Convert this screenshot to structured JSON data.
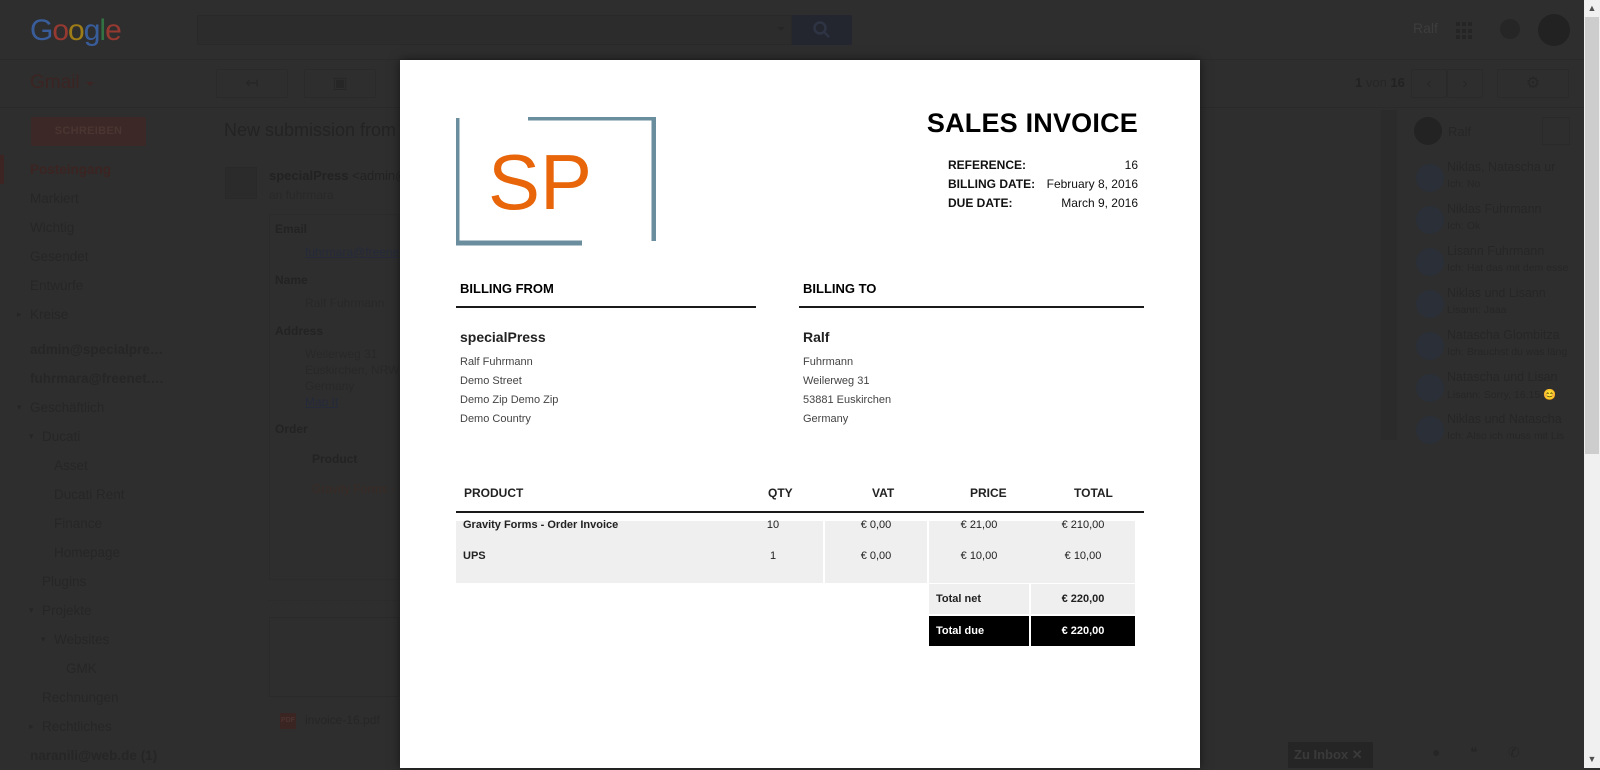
{
  "header": {
    "logo_letters": [
      {
        "ch": "G",
        "color": "#4285f4"
      },
      {
        "ch": "o",
        "color": "#ea4335"
      },
      {
        "ch": "o",
        "color": "#fbbc05"
      },
      {
        "ch": "g",
        "color": "#4285f4"
      },
      {
        "ch": "l",
        "color": "#34a853"
      },
      {
        "ch": "e",
        "color": "#ea4335"
      }
    ],
    "search_placeholder": "",
    "user_name": "Ralf"
  },
  "toolbar": {
    "app_label": "Gmail",
    "reply_icon": "↤",
    "archive_icon": "▣",
    "pager": {
      "current": "1",
      "of_label": "von",
      "total": "16"
    },
    "prev_icon": "‹",
    "next_icon": "›",
    "settings_icon": "⚙"
  },
  "sidebar": {
    "compose_label": "SCHREIBEN",
    "items": [
      {
        "label": "Posteingang",
        "style": "active",
        "indent": 0
      },
      {
        "label": "Markiert",
        "style": "",
        "indent": 0
      },
      {
        "label": "Wichtig",
        "style": "",
        "indent": 0
      },
      {
        "label": "Gesendet",
        "style": "",
        "indent": 0
      },
      {
        "label": "Entwürfe",
        "style": "",
        "indent": 0
      },
      {
        "label": "Kreise",
        "style": "",
        "indent": 0,
        "arrow": "▸"
      },
      {
        "label": "admin@specialpre…",
        "style": "bold",
        "indent": 0
      },
      {
        "label": "fuhrmara@freenet.…",
        "style": "bold",
        "indent": 0
      },
      {
        "label": "Geschäftlich",
        "style": "",
        "indent": 0,
        "arrow": "▾"
      },
      {
        "label": "Ducati",
        "style": "",
        "indent": 1,
        "arrow": "▾"
      },
      {
        "label": "Asset",
        "style": "",
        "indent": 2
      },
      {
        "label": "Ducati Rent",
        "style": "",
        "indent": 2
      },
      {
        "label": "Finance",
        "style": "",
        "indent": 2
      },
      {
        "label": "Homepage",
        "style": "",
        "indent": 2
      },
      {
        "label": "Plugins",
        "style": "",
        "indent": 1
      },
      {
        "label": "Projekte",
        "style": "",
        "indent": 1,
        "arrow": "▾"
      },
      {
        "label": "Websites",
        "style": "",
        "indent": 2,
        "arrow": "▾"
      },
      {
        "label": "GMK",
        "style": "",
        "indent": 3
      },
      {
        "label": "Rechnungen",
        "style": "",
        "indent": 1
      },
      {
        "label": "Rechtliches",
        "style": "",
        "indent": 1,
        "arrow": "▸"
      },
      {
        "label": "naranili@web.de (1)",
        "style": "bold",
        "indent": 0
      }
    ]
  },
  "message": {
    "subject": "New submission from S",
    "sender_name": "specialPress",
    "sender_email": "<admin@",
    "recipient": "an fuhrmara",
    "fields": [
      {
        "label": "Email",
        "value": "fuhrmara@freene",
        "link": true
      },
      {
        "label": "Name",
        "value": "Ralf Fuhrmann"
      },
      {
        "label": "Address",
        "lines": [
          "Weilerweg 31",
          "Euskirchen, NRW",
          "Germany"
        ],
        "link_text": "Map It"
      },
      {
        "label": "Order"
      }
    ],
    "order_head": "Product",
    "order_item": "Gravity Forms -",
    "attachment": {
      "badge": "PDF",
      "name": "invoice-16.pdf"
    }
  },
  "hangouts": {
    "user_name": "Ralf",
    "contacts": [
      {
        "name": "Niklas, Natascha ur",
        "msg": "Ich: No"
      },
      {
        "name": "Niklas Fuhrmann",
        "msg": "Ich: Ok"
      },
      {
        "name": "Lisann Fuhrmann",
        "msg": "Ich: Hat das mit dem esse"
      },
      {
        "name": "Niklas und Lisann",
        "msg": "Lisann: Jaaa"
      },
      {
        "name": "Natascha Glombitza",
        "msg": "Ich: Brauchst du was läng"
      },
      {
        "name": "Natascha und Lisan",
        "msg": "Lisann: Sorry, 16.15 😊"
      },
      {
        "name": "Niklas und Natascha",
        "msg": "Ich: Also ich muss mit Lis"
      }
    ],
    "zu_inbox_label": "Zu Inbox ✕"
  },
  "invoice": {
    "logo_text": "SP",
    "title": "SALES INVOICE",
    "meta": [
      {
        "key": "REFERENCE:",
        "value": "16"
      },
      {
        "key": "BILLING DATE:",
        "value": "February 8, 2016"
      },
      {
        "key": "DUE DATE:",
        "value": "March 9, 2016"
      }
    ],
    "billing_from": {
      "heading": "BILLING FROM",
      "name": "specialPress",
      "lines": [
        "Ralf Fuhrmann",
        "Demo Street",
        "Demo Zip Demo Zip",
        "Demo Country"
      ]
    },
    "billing_to": {
      "heading": "BILLING TO",
      "name": "Ralf",
      "lines": [
        "Fuhrmann",
        "Weilerweg 31",
        "53881 Euskirchen",
        "Germany"
      ]
    },
    "columns": [
      "PRODUCT",
      "QTY",
      "VAT",
      "PRICE",
      "TOTAL"
    ],
    "rows": [
      {
        "product": "Gravity Forms - Order Invoice",
        "qty": "10",
        "vat": "€ 0,00",
        "price": "€ 21,00",
        "total": "€ 210,00"
      },
      {
        "product": "UPS",
        "qty": "1",
        "vat": "€ 0,00",
        "price": "€ 10,00",
        "total": "€ 10,00"
      }
    ],
    "total_net_label": "Total net",
    "total_net": "€ 220,00",
    "total_due_label": "Total due",
    "total_due": "€ 220,00",
    "colors": {
      "logo_orange": "#e8650a",
      "logo_frame": "#6b8e9e",
      "row_bg": "#efefef",
      "due_bg": "#000000"
    }
  }
}
